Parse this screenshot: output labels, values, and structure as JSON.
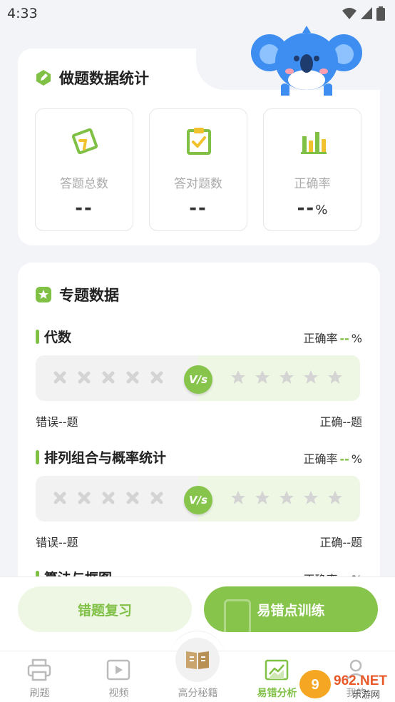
{
  "status_bar": {
    "time": "4:33"
  },
  "stats_card": {
    "title": "做题数据统计",
    "items": [
      {
        "label": "答题总数",
        "value": "--",
        "unit": ""
      },
      {
        "label": "答对题数",
        "value": "--",
        "unit": ""
      },
      {
        "label": "正确率",
        "value": "--",
        "unit": "%"
      }
    ]
  },
  "topic_card": {
    "title": "专题数据",
    "topics": [
      {
        "name": "代数",
        "rate_prefix": "正确率",
        "rate_value": "--",
        "rate_unit": "%",
        "vs": "V/s",
        "wrong_label": "错误--题",
        "right_label": "正确--题"
      },
      {
        "name": "排列组合与概率统计",
        "rate_prefix": "正确率",
        "rate_value": "--",
        "rate_unit": "%",
        "vs": "V/s",
        "wrong_label": "错误--题",
        "right_label": "正确--题"
      },
      {
        "name": "算法与框图",
        "rate_prefix": "正确率",
        "rate_value": "--",
        "rate_unit": "%"
      }
    ]
  },
  "actions": {
    "review_label": "错题复习",
    "train_label": "易错点训练"
  },
  "tabs": [
    {
      "label": "刷题",
      "icon": "printer-icon"
    },
    {
      "label": "视频",
      "icon": "video-icon"
    },
    {
      "label": "高分秘籍",
      "icon": "book-icon"
    },
    {
      "label": "易错分析",
      "icon": "chart-icon",
      "active": true
    },
    {
      "label": "我的",
      "icon": "user-icon"
    }
  ],
  "watermark": {
    "text": "962.NET",
    "subtext": "乐游网"
  },
  "colors": {
    "accent": "#86c44b",
    "accent_light": "#eef7e4",
    "background": "#f3f4f8"
  }
}
